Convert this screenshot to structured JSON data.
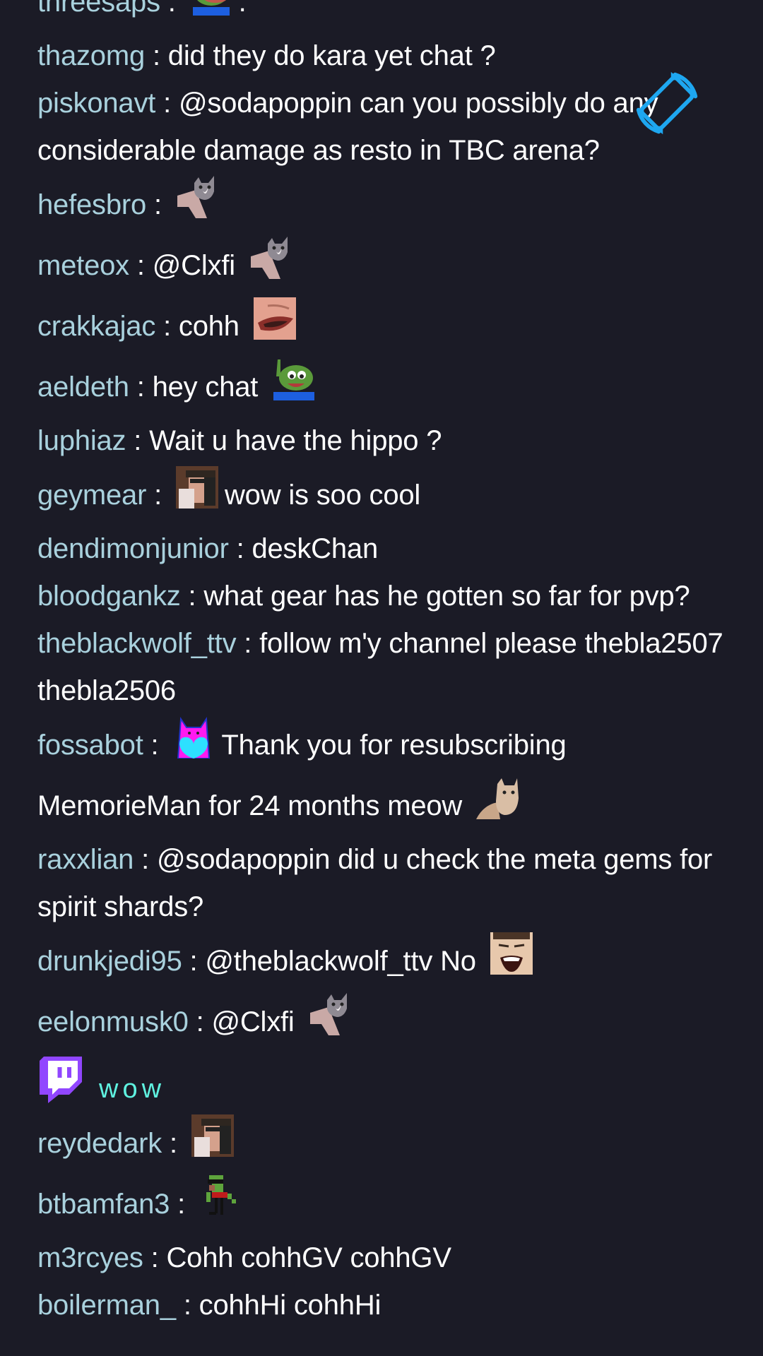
{
  "colors": {
    "background": "#1b1b26",
    "username": "#a9d1dd",
    "message": "#ffffff",
    "system_message": "#5ff2e0",
    "twitch_purple": "#9146ff",
    "rotate_icon": "#1ea7f0"
  },
  "separator": ":",
  "messages": [
    {
      "user": "threesaps",
      "parts": [
        {
          "emote": "pepe-blue-shirt"
        },
        {
          "text": "."
        }
      ],
      "sep": ".",
      "tall": true
    },
    {
      "user": "thazomg",
      "parts": [
        {
          "text": "did they do kara yet chat ?"
        }
      ]
    },
    {
      "user": "piskonavt",
      "parts": [
        {
          "text": "@sodapoppin can you possibly do any considerable damage as resto in TBC arena?"
        }
      ]
    },
    {
      "user": "hefesbro",
      "parts": [
        {
          "emote": "cat-dance"
        }
      ],
      "tall": true
    },
    {
      "user": "meteox",
      "parts": [
        {
          "text": "@Clxfi"
        },
        {
          "emote": "cat-dance"
        }
      ],
      "tall": true
    },
    {
      "user": "crakkajac",
      "parts": [
        {
          "text": "cohh"
        },
        {
          "emote": "mouth-face"
        }
      ],
      "tall": true
    },
    {
      "user": "aeldeth",
      "parts": [
        {
          "text": "hey chat"
        },
        {
          "emote": "pepe-wave"
        }
      ],
      "tall": true
    },
    {
      "user": "luphiaz",
      "parts": [
        {
          "text": "Wait u have the hippo ?"
        }
      ]
    },
    {
      "user": "geymear",
      "parts": [
        {
          "emote": "streamer-eating"
        },
        {
          "text": "wow is soo cool"
        }
      ],
      "tall": true
    },
    {
      "user": "dendimonjunior",
      "parts": [
        {
          "text": "deskChan"
        }
      ]
    },
    {
      "user": "bloodgankz",
      "parts": [
        {
          "text": "what gear has he gotten so far for pvp?"
        }
      ]
    },
    {
      "user": "theblackwolf_ttv",
      "parts": [
        {
          "text": "follow m'y channel please thebla2507 thebla2506"
        }
      ]
    },
    {
      "user": "fossabot",
      "parts": [
        {
          "emote": "pink-cat-heart"
        },
        {
          "text": "Thank you for resubscribing MemorieMan for 24 months meow"
        },
        {
          "emote": "cat-stare"
        }
      ],
      "tall": true
    },
    {
      "user": "raxxlian",
      "parts": [
        {
          "text": "@sodapoppin did u check the meta gems for spirit shards?"
        }
      ]
    },
    {
      "user": "drunkjedi95",
      "parts": [
        {
          "text": "@theblackwolf_ttv No"
        },
        {
          "emote": "laughing-face"
        }
      ],
      "tall": true
    },
    {
      "user": "eelonmusk0",
      "parts": [
        {
          "text": "@Clxfi"
        },
        {
          "emote": "cat-dance"
        }
      ],
      "tall": true
    },
    {
      "system": true,
      "badge": "twitch-glitch",
      "text": "wow"
    },
    {
      "user": "reydedark",
      "parts": [
        {
          "emote": "streamer-eating"
        }
      ],
      "tall": true
    },
    {
      "user": "btbamfan3",
      "parts": [
        {
          "emote": "pixel-pepe-walk"
        }
      ],
      "tall": true
    },
    {
      "user": "m3rcyes",
      "parts": [
        {
          "text": "Cohh cohhGV cohhGV"
        }
      ]
    },
    {
      "user": "boilerman_",
      "parts": [
        {
          "text": "cohhHi cohhHi"
        }
      ]
    }
  ],
  "overlay": {
    "rotate_icon": "screen-rotate-icon"
  }
}
